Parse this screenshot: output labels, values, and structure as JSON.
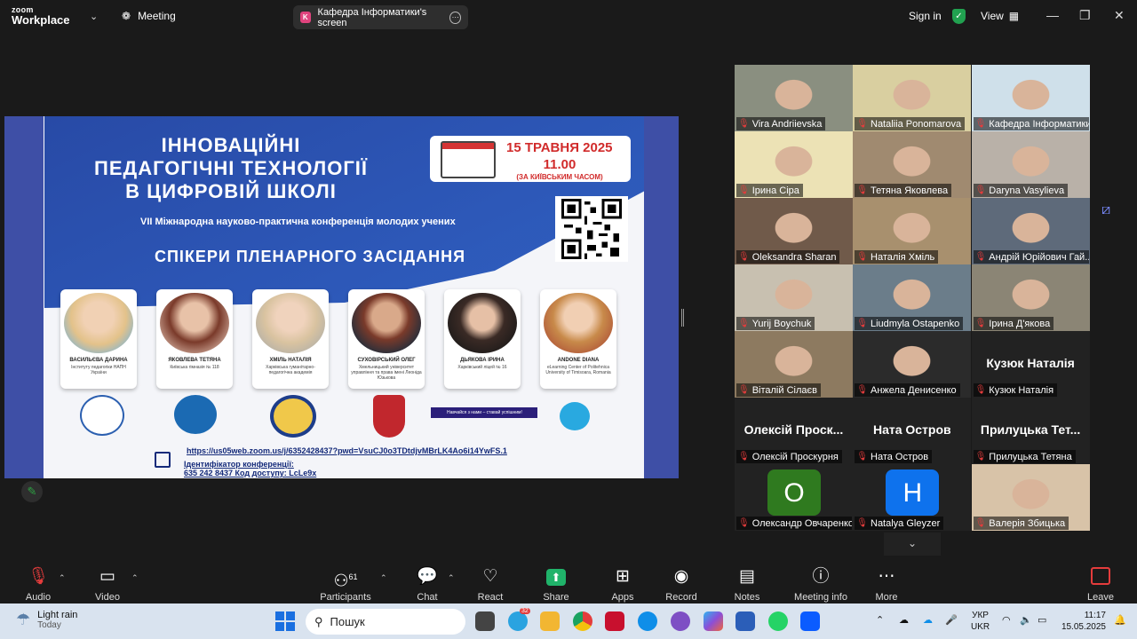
{
  "topbar": {
    "logo_line1": "zoom",
    "logo_line2": "Workplace",
    "meeting_label": "Meeting",
    "screen_badge": "K",
    "screen_title": "Кафедра Інформатики's screen",
    "signin": "Sign in",
    "view": "View"
  },
  "slide": {
    "title_lines": [
      "ІННОВАЦІЙНІ",
      "ПЕДАГОГІЧНІ ТЕХНОЛОГІЇ",
      "В ЦИФРОВІЙ ШКОЛІ"
    ],
    "date": "15 ТРАВНЯ 2025",
    "time": "11.00",
    "timezone": "(ЗА КИЇВСЬКИМ ЧАСОМ)",
    "conference": "VII Міжнародна науково-практична конференція молодих учених",
    "speakers_heading": "СПІКЕРИ ПЛЕНАРНОГО ЗАСІДАННЯ",
    "speakers": [
      {
        "name": "ВАСИЛЬЄВА ДАРИНА",
        "affil": "Інституту педагогіки НАПН України"
      },
      {
        "name": "ЯКОВЛЕВА ТЕТЯНА",
        "affil": "Київська гімназія № 118"
      },
      {
        "name": "ХМІЛЬ НАТАЛІЯ",
        "affil": "Харківська гуманітарно-педагогічна академія"
      },
      {
        "name": "СУХОВІРСЬКИЙ ОЛЕГ",
        "affil": "Хмельницький університет управління та права імені Леоніда Юзькова"
      },
      {
        "name": "ДЬЯКОВА ІРИНА",
        "affil": "Харківський ліцей № 16"
      },
      {
        "name": "ANDONE DIANA",
        "affil": "eLearning Center of Politehnica University of Timisoara, Romania"
      }
    ],
    "banner_text": "Навчайся з нами – ставай успішним!",
    "link": "https://us05web.zoom.us/j/6352428437?pwd=VsuCJ0o3TDtdjvMBrLK4Ao6i14YwFS.1",
    "conf_id_label": "Ідентифікатор конференції:",
    "conf_id_value": "635 242 8437 Код доступу: LcLe9x"
  },
  "participants": [
    {
      "name": "Vira Andriievska",
      "big": ""
    },
    {
      "name": "Nataliia Ponomarova",
      "big": ""
    },
    {
      "name": "Кафедра Інформатики",
      "big": "",
      "active": true
    },
    {
      "name": "Ірина Сіра",
      "big": ""
    },
    {
      "name": "Тетяна Яковлева",
      "big": ""
    },
    {
      "name": "Daryna Vasylieva",
      "big": ""
    },
    {
      "name": "Oleksandra Sharan",
      "big": ""
    },
    {
      "name": "Наталія Хміль",
      "big": ""
    },
    {
      "name": "Андрій Юрійович Гай...",
      "big": ""
    },
    {
      "name": "Yurij Boychuk",
      "big": ""
    },
    {
      "name": "Liudmyla Ostapenko",
      "big": ""
    },
    {
      "name": "Ірина Д'якова",
      "big": ""
    },
    {
      "name": "Віталій Сілаєв",
      "big": ""
    },
    {
      "name": "Анжела Денисенко",
      "big": ""
    },
    {
      "name": "Кузюк Наталія",
      "big": "Кузюк Наталія"
    },
    {
      "name": "Олексій Проскурня",
      "big": "Олексій Проск..."
    },
    {
      "name": "Ната Остров",
      "big": "Ната Остров"
    },
    {
      "name": "Прилуцька Тетяна",
      "big": "Прилуцька Тет..."
    },
    {
      "name": "Олександр Овчаренко",
      "big": "",
      "avatar": "O",
      "avatar_color": "#2f7a1f"
    },
    {
      "name": "Natalya Gleyzer",
      "big": "",
      "avatar": "H",
      "avatar_color": "#0e72ed"
    },
    {
      "name": "Валерія Збицька",
      "big": ""
    }
  ],
  "toolbar": {
    "audio": "Audio",
    "video": "Video",
    "participants": "Participants",
    "participants_count": "61",
    "chat": "Chat",
    "react": "React",
    "share": "Share",
    "apps": "Apps",
    "record": "Record",
    "notes": "Notes",
    "meeting_info": "Meeting info",
    "more": "More",
    "leave": "Leave"
  },
  "taskbar": {
    "weather_title": "Light rain",
    "weather_sub": "Today",
    "search_placeholder": "Пошук",
    "badge_count": "32",
    "lang1": "УКР",
    "lang2": "UKR",
    "time": "11:17",
    "date": "15.05.2025"
  },
  "colors": {
    "zoom_green": "#2ed18a",
    "share_green": "#20b36a",
    "muted_red": "#e43c3c",
    "slide_blue": "#284aa6"
  }
}
